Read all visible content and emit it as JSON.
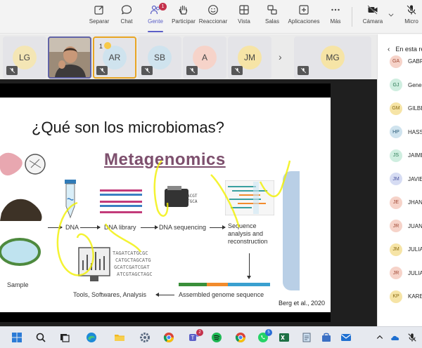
{
  "toolbar": {
    "buttons": [
      {
        "label": "Separar",
        "icon": "pop-out-icon"
      },
      {
        "label": "Chat",
        "icon": "chat-icon"
      },
      {
        "label": "Gente",
        "icon": "people-icon",
        "badge": "1",
        "active": true
      },
      {
        "label": "Participar",
        "icon": "raise-hand-icon"
      },
      {
        "label": "Reaccionar",
        "icon": "smiley-icon"
      },
      {
        "label": "Vista",
        "icon": "grid-view-icon"
      },
      {
        "label": "Salas",
        "icon": "breakout-rooms-icon"
      },
      {
        "label": "Aplicaciones",
        "icon": "add-apps-icon"
      },
      {
        "label": "Más",
        "icon": "more-icon"
      },
      {
        "label": "Cámara",
        "icon": "camera-off-icon"
      },
      {
        "label": "Micro",
        "icon": "mic-off-icon"
      }
    ]
  },
  "participants_strip": [
    {
      "initials": "LG",
      "color": "#f4e6b5",
      "muted": true
    },
    {
      "initials": "",
      "video": true,
      "speaking": true,
      "muted": false
    },
    {
      "initials": "AR",
      "color": "#cfe3ee",
      "muted": true,
      "hand_raised": true,
      "hand_number": "1"
    },
    {
      "initials": "SB",
      "color": "#cfe3ee",
      "muted": true
    },
    {
      "initials": "A",
      "color": "#f6d3c9",
      "muted": true
    },
    {
      "initials": "JM",
      "color": "#f6e4a6",
      "muted": true
    },
    {
      "initials": "MG",
      "color": "#f6e4a6",
      "muted": true
    }
  ],
  "slide": {
    "title": "¿Qué son los microbiomas?",
    "heading": "Metagenomics",
    "labels": {
      "dna": "DNA",
      "dna_library": "DNA library",
      "dna_sequencing": "DNA sequencing",
      "seq_analysis": "Sequence analysis and reconstruction",
      "sample": "Sample",
      "tools": "Tools, Softwares, Analysis",
      "assembled": "Assembled genome sequence"
    },
    "citation": "Berg et al., 2020"
  },
  "side_panel": {
    "title": "En esta reunión",
    "people": [
      {
        "initials": "GA",
        "name": "GABRIELA",
        "color": "#f6d3c9"
      },
      {
        "initials": "GJ",
        "name": "Genesis",
        "color": "#cfeee0"
      },
      {
        "initials": "GM",
        "name": "GILBERTO",
        "color": "#f6e4a6"
      },
      {
        "initials": "HP",
        "name": "HASSAN",
        "color": "#cfe3ee"
      },
      {
        "initials": "JS",
        "name": "JAIME",
        "color": "#cfeee0"
      },
      {
        "initials": "JM",
        "name": "JAVIER",
        "color": "#d6dcf3"
      },
      {
        "initials": "JE",
        "name": "JHANELLA",
        "color": "#f6d3c9"
      },
      {
        "initials": "JR",
        "name": "JUAN",
        "color": "#f6d3c9"
      },
      {
        "initials": "JM",
        "name": "JULIA",
        "color": "#f6e4a6"
      },
      {
        "initials": "JR",
        "name": "JULIANA",
        "color": "#f6d3c9"
      },
      {
        "initials": "KP",
        "name": "KAREN",
        "color": "#f6e4a6"
      }
    ]
  },
  "taskbar": {
    "apps": [
      {
        "icon": "windows-start-icon"
      },
      {
        "icon": "search-icon"
      },
      {
        "icon": "task-view-icon"
      },
      {
        "icon": "edge-icon"
      },
      {
        "icon": "file-explorer-icon"
      },
      {
        "icon": "settings-icon"
      },
      {
        "icon": "chrome-icon"
      },
      {
        "icon": "teams-icon",
        "badge": "2"
      },
      {
        "icon": "spotify-icon"
      },
      {
        "icon": "chrome-icon"
      },
      {
        "icon": "whatsapp-icon",
        "badge": "5"
      },
      {
        "icon": "excel-icon"
      },
      {
        "icon": "notepad-icon"
      },
      {
        "icon": "store-icon"
      },
      {
        "icon": "mail-icon"
      }
    ]
  }
}
